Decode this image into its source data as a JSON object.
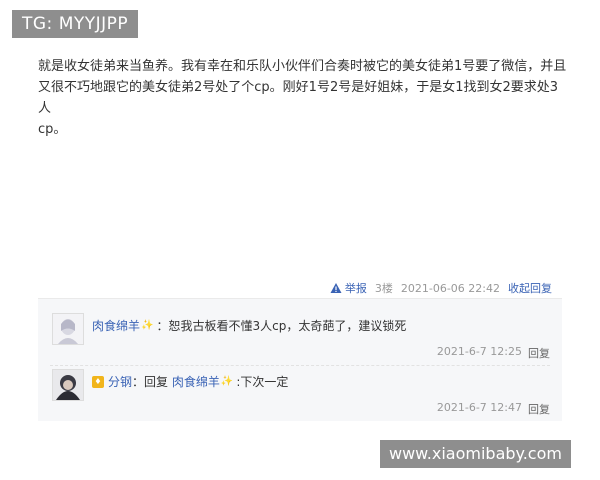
{
  "watermark_top": "TG: MYYJJPP",
  "post": {
    "body_line1": "就是收女徒弟来当鱼养。我有幸在和乐队小伙伴们合奏时被它的美女徒弟1号要了微信，并且",
    "body_line2": "又很不巧地跟它的美女徒弟2号处了个cp。刚好1号2号是好姐妹，于是女1找到女2要求处3人",
    "body_line3": "cp。",
    "report_label": "举报",
    "floor": "3楼",
    "timestamp": "2021-06-06 22:42",
    "collapse_label": "收起回复"
  },
  "replies": [
    {
      "user": "肉食绵羊",
      "separator": "：",
      "text": "恕我古板看不懂3人cp，太奇葩了，建议锁死",
      "date": "2021-6-7 12:25",
      "reply_label": "回复"
    },
    {
      "user": "分钢",
      "reply_word": "回复",
      "target_user": "肉食绵羊",
      "separator": ":",
      "text": "下次一定",
      "date": "2021-6-7 12:47",
      "reply_label": "回复"
    }
  ],
  "watermark_bottom": "www.xiaomibaby.com",
  "colors": {
    "link": "#3a63b5",
    "meta": "#999999",
    "watermark_bg": "#8e8e8e",
    "subreply_bg": "#f6f7f9"
  }
}
